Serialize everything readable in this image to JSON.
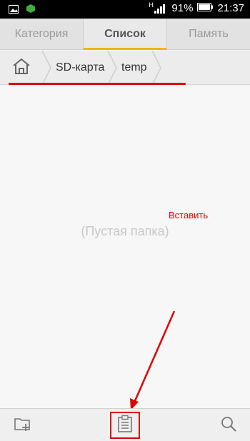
{
  "status_bar": {
    "signal_letter": "H",
    "battery_percent": "91%",
    "time": "21:37"
  },
  "tabs": [
    {
      "label": "Категория",
      "active": false
    },
    {
      "label": "Список",
      "active": true
    },
    {
      "label": "Память",
      "active": false
    }
  ],
  "breadcrumb": {
    "items": [
      "SD-карта",
      "temp"
    ]
  },
  "content": {
    "empty_text": "(Пустая папка)"
  },
  "annotation": {
    "label": "Вставить",
    "color": "#e00000"
  },
  "bottom_bar": {
    "icons": [
      "new-folder-icon",
      "paste-icon",
      "search-icon"
    ]
  },
  "colors": {
    "accent": "#f0b400",
    "annotation_red": "#e00000"
  }
}
